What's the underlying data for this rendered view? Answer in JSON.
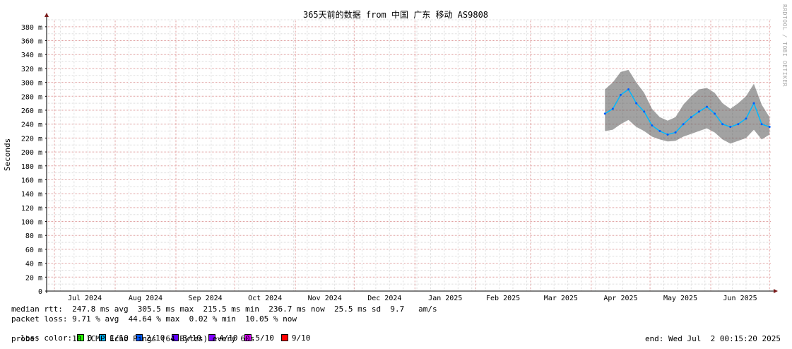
{
  "chart_data": {
    "type": "line",
    "title": "365天前的数据 from 中国 广东 移动 AS9808",
    "ylabel": "Seconds",
    "ylim": [
      0,
      390
    ],
    "y_ticks": [
      "0",
      "20 m",
      "40 m",
      "60 m",
      "80 m",
      "100 m",
      "120 m",
      "140 m",
      "160 m",
      "180 m",
      "200 m",
      "220 m",
      "240 m",
      "260 m",
      "280 m",
      "300 m",
      "320 m",
      "340 m",
      "360 m",
      "380 m"
    ],
    "x_ticks": [
      "Jul 2024",
      "Aug 2024",
      "Sep 2024",
      "Oct 2024",
      "Nov 2024",
      "Dec 2024",
      "Jan 2025",
      "Feb 2025",
      "Mar 2025",
      "Apr 2025",
      "May 2025",
      "Jun 2025"
    ],
    "grid": true,
    "series": [
      {
        "x": [
          "2025-04-08",
          "2025-04-12",
          "2025-04-16",
          "2025-04-20",
          "2025-04-24",
          "2025-04-28",
          "2025-05-02",
          "2025-05-06",
          "2025-05-10",
          "2025-05-14",
          "2025-05-18",
          "2025-05-22",
          "2025-05-26",
          "2025-05-30",
          "2025-06-03",
          "2025-06-07",
          "2025-06-11",
          "2025-06-15",
          "2025-06-19",
          "2025-06-23",
          "2025-06-27",
          "2025-07-01"
        ],
        "values": [
          255,
          262,
          282,
          290,
          270,
          258,
          238,
          230,
          225,
          228,
          240,
          250,
          258,
          265,
          255,
          240,
          236,
          240,
          248,
          270,
          240,
          236
        ],
        "min": [
          230,
          232,
          240,
          246,
          236,
          230,
          222,
          218,
          215,
          216,
          222,
          226,
          230,
          234,
          228,
          218,
          212,
          216,
          220,
          232,
          218,
          225
        ],
        "max": [
          290,
          300,
          315,
          318,
          300,
          285,
          262,
          250,
          245,
          250,
          268,
          280,
          290,
          292,
          285,
          270,
          262,
          270,
          280,
          298,
          268,
          250
        ]
      }
    ]
  },
  "stats": {
    "median_rtt": "median rtt:  247.8 ms avg  305.5 ms max  215.5 ms min  236.7 ms now  25.5 ms sd  9.7   am/s",
    "packet_loss": "packet loss: 9.71 % avg  44.64 % max  0.02 % min  10.05 % now",
    "loss_color_label": "loss color: ",
    "loss_colors": [
      {
        "label": "0",
        "color": "#26ff00"
      },
      {
        "label": "1/10",
        "color": "#00b8ff"
      },
      {
        "label": "2/10",
        "color": "#0059ff"
      },
      {
        "label": "3/10",
        "color": "#5e00ff"
      },
      {
        "label": "4/10",
        "color": "#7e00ff"
      },
      {
        "label": "5/10",
        "color": "#dd00ff"
      },
      {
        "label": "9/10",
        "color": "#ff0000"
      }
    ],
    "probe": "probe:       10 ICMP Echo Pings (64 Bytes) every 60s",
    "end": "end: Wed Jul  2 00:15:20 2025"
  },
  "watermark": "RRDTOOL / TOBI OETIKER"
}
